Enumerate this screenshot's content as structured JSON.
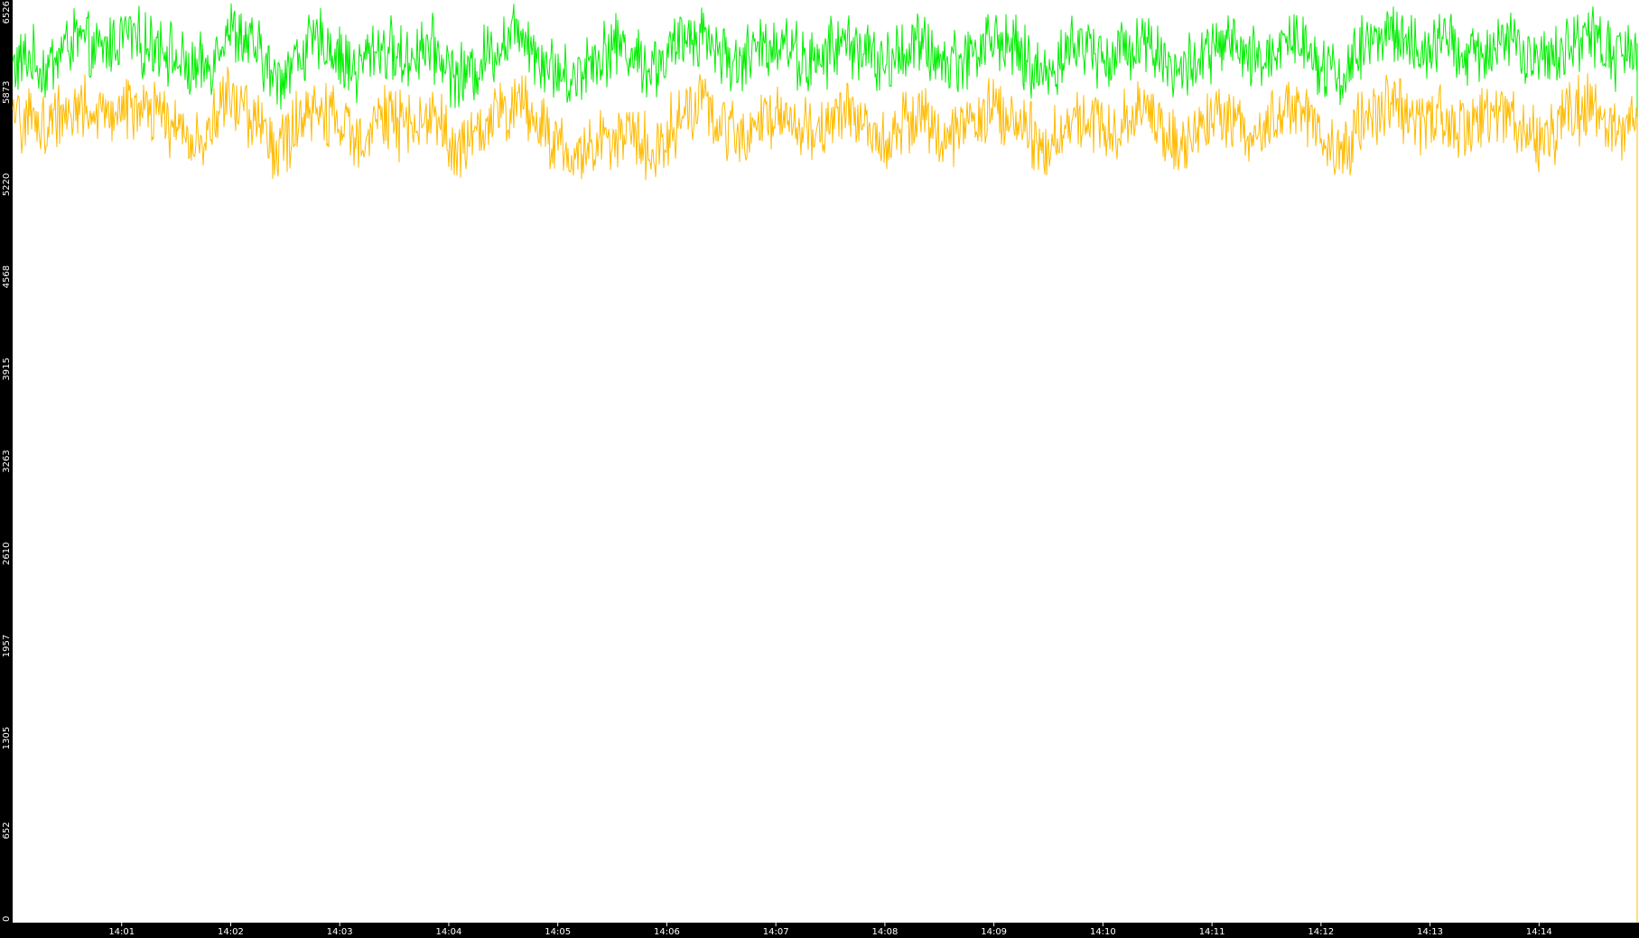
{
  "chart_data": {
    "type": "line",
    "title": "",
    "xlabel": "",
    "ylabel": "",
    "colors": {
      "background": "#000000",
      "plot_area": "#ffffff",
      "axis_text": "#ffffff"
    },
    "grid": false,
    "legend": "none",
    "ylim": [
      0,
      6526
    ],
    "yticks": [
      "0",
      "652",
      "1305",
      "1957",
      "2610",
      "3263",
      "3915",
      "4568",
      "5220",
      "5873",
      "6526"
    ],
    "xticks": [
      "14:01",
      "14:02",
      "14:03",
      "14:04",
      "14:05",
      "14:06",
      "14:07",
      "14:08",
      "14:09",
      "14:10",
      "14:11",
      "14:12",
      "14:13",
      "14:14"
    ],
    "x_time_range": [
      "14:00:00",
      "14:14:55"
    ],
    "series": [
      {
        "color": "#00ee00",
        "values": [
          6050,
          6120,
          6020,
          6180,
          6260,
          6140,
          6210,
          6300,
          6190,
          6240,
          6090,
          6010,
          6060,
          6330,
          6250,
          6150,
          5950,
          6080,
          6190,
          6240,
          6110,
          6020,
          6200,
          6170,
          6090,
          6220,
          6140,
          5980,
          6010,
          6160,
          6230,
          6350,
          6130,
          6050,
          5940,
          6090,
          6160,
          6220,
          6120,
          6040,
          6140,
          6260,
          6300,
          6180,
          6070,
          6140,
          6210,
          6250,
          6110,
          6060,
          6200,
          6230,
          6160,
          6050,
          6140,
          6220,
          6150,
          6080,
          6120,
          6200,
          6260,
          6180,
          6060,
          5990,
          6140,
          6220,
          6170,
          6100,
          6210,
          6250,
          6140,
          5990,
          6090,
          6150,
          6230,
          6120,
          6080,
          6190,
          6270,
          6200,
          6050,
          5980,
          6150,
          6240,
          6330,
          6200,
          6140,
          6230,
          6180,
          6100,
          6200,
          6260,
          6150,
          6050,
          6120,
          6240,
          6300,
          6190,
          6110,
          6220
        ],
        "series_color_role": "upper"
      },
      {
        "color": "#ffbb00",
        "values": [
          5650,
          5700,
          5620,
          5740,
          5790,
          5680,
          5720,
          5800,
          5700,
          5740,
          5610,
          5530,
          5590,
          5830,
          5760,
          5670,
          5450,
          5600,
          5700,
          5740,
          5620,
          5540,
          5710,
          5690,
          5600,
          5720,
          5660,
          5470,
          5510,
          5660,
          5730,
          5850,
          5640,
          5560,
          5380,
          5470,
          5540,
          5610,
          5530,
          5470,
          5600,
          5730,
          5790,
          5670,
          5570,
          5630,
          5700,
          5740,
          5610,
          5560,
          5690,
          5720,
          5660,
          5560,
          5630,
          5710,
          5640,
          5580,
          5620,
          5690,
          5750,
          5680,
          5580,
          5480,
          5620,
          5700,
          5660,
          5600,
          5700,
          5740,
          5640,
          5490,
          5580,
          5640,
          5720,
          5620,
          5580,
          5680,
          5760,
          5690,
          5550,
          5460,
          5620,
          5720,
          5810,
          5690,
          5620,
          5710,
          5670,
          5600,
          5690,
          5750,
          5640,
          5550,
          5620,
          5720,
          5790,
          5680,
          5590,
          5700
        ],
        "series_color_role": "lower"
      }
    ]
  }
}
